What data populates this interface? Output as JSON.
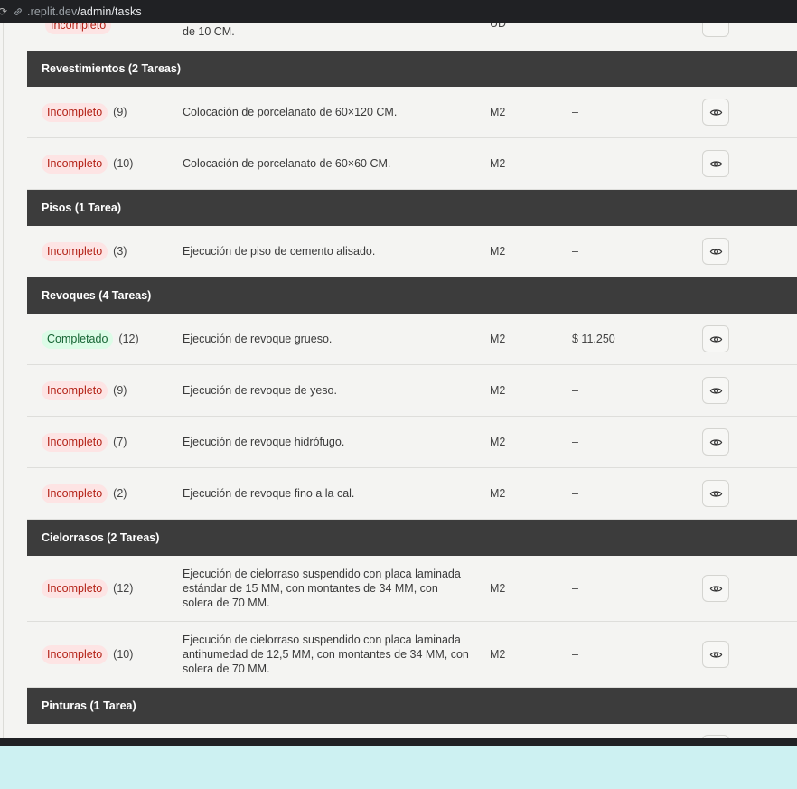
{
  "browser": {
    "url_host": ".replit.dev",
    "url_path": "/admin/tasks"
  },
  "partial_row": {
    "status": "Incompleto",
    "description": "de 10 CM.",
    "unit": "UD"
  },
  "groups": [
    {
      "title": "Revestimientos (2 Tareas)",
      "rows": [
        {
          "status": "Incompleto",
          "count": "(9)",
          "description": "Colocación de porcelanato de 60×120 CM.",
          "unit": "M2",
          "price": "–"
        },
        {
          "status": "Incompleto",
          "count": "(10)",
          "description": "Colocación de porcelanato de 60×60 CM.",
          "unit": "M2",
          "price": "–"
        }
      ]
    },
    {
      "title": "Pisos (1 Tarea)",
      "rows": [
        {
          "status": "Incompleto",
          "count": "(3)",
          "description": "Ejecución de piso de cemento alisado.",
          "unit": "M2",
          "price": "–"
        }
      ]
    },
    {
      "title": "Revoques (4 Tareas)",
      "rows": [
        {
          "status": "Completado",
          "count": "(12)",
          "description": "Ejecución de revoque grueso.",
          "unit": "M2",
          "price": "$ 11.250"
        },
        {
          "status": "Incompleto",
          "count": "(9)",
          "description": "Ejecución de revoque de yeso.",
          "unit": "M2",
          "price": "–"
        },
        {
          "status": "Incompleto",
          "count": "(7)",
          "description": "Ejecución de revoque hidrófugo.",
          "unit": "M2",
          "price": "–"
        },
        {
          "status": "Incompleto",
          "count": "(2)",
          "description": "Ejecución de revoque fino a la cal.",
          "unit": "M2",
          "price": "–"
        }
      ]
    },
    {
      "title": "Cielorrasos (2 Tareas)",
      "rows": [
        {
          "status": "Incompleto",
          "count": "(12)",
          "description": "Ejecución de cielorraso suspendido con placa laminada estándar de 15 MM, con montantes de 34 MM, con solera de 70 MM.",
          "unit": "M2",
          "price": "–"
        },
        {
          "status": "Incompleto",
          "count": "(10)",
          "description": "Ejecución de cielorraso suspendido con placa laminada antihumedad de 12,5 MM, con montantes de 34 MM, con solera de 70 MM.",
          "unit": "M2",
          "price": "–"
        }
      ]
    },
    {
      "title": "Pinturas (1 Tarea)",
      "rows": []
    }
  ],
  "icons": {
    "view": "eye-icon",
    "link": "link-icon"
  },
  "colors": {
    "group_header": "#3c3c3c",
    "incompleto_bg": "#fde4e4",
    "incompleto_text": "#b42318",
    "completado_bg": "#dcfce7",
    "completado_text": "#166534"
  }
}
